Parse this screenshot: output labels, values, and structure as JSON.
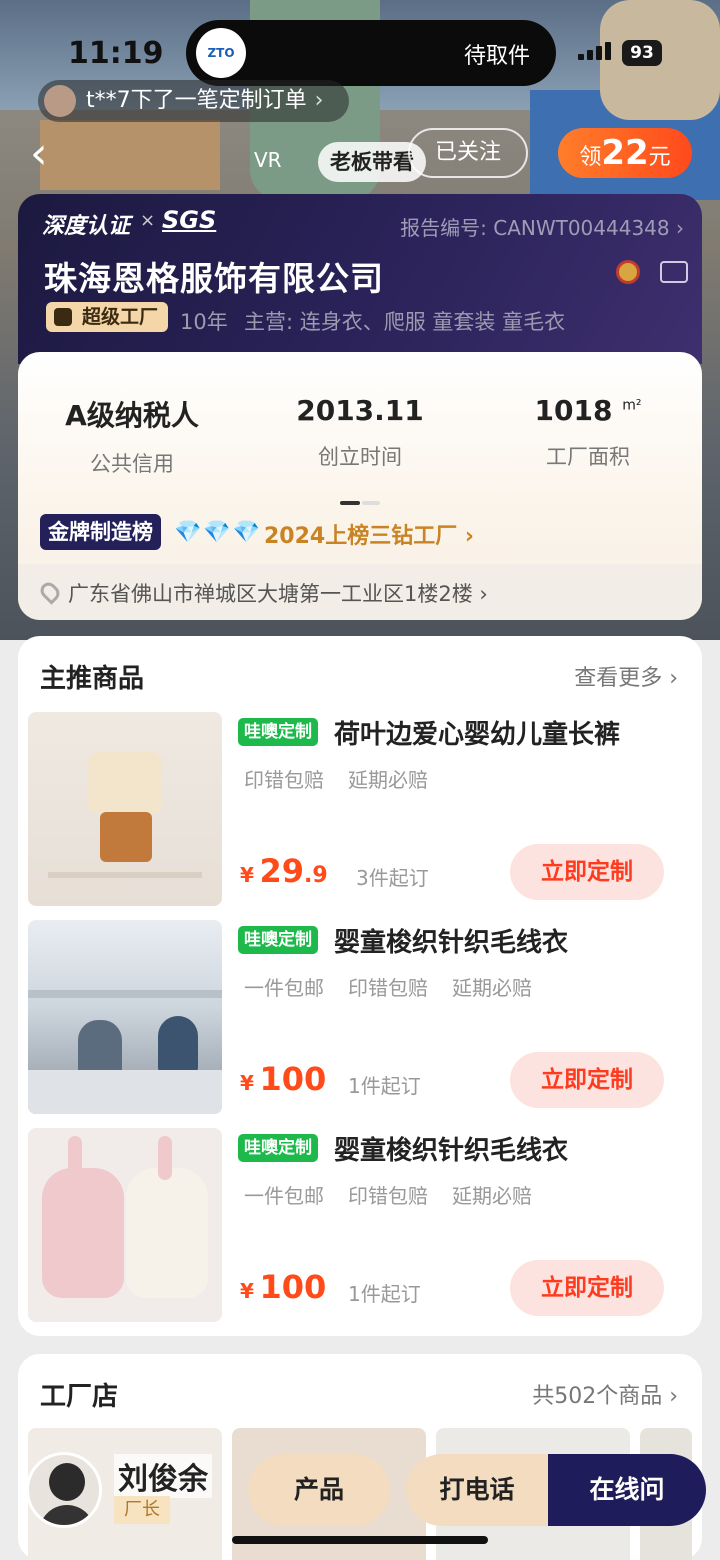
{
  "status_bar": {
    "time": "11:19",
    "island_text": "待取件",
    "island_logo": "ZTO",
    "battery": "93"
  },
  "ticker": {
    "text": "t**7下了一笔定制订单",
    "chevron": "›"
  },
  "nav": {
    "back": "‹",
    "vr": "VR",
    "boss_tour": "老板带看",
    "follow": "已关注"
  },
  "coupon": {
    "prefix": "领",
    "amount": "22",
    "unit": "元"
  },
  "cert": {
    "brand": "深度认证",
    "times": "×",
    "sgs": "SGS",
    "report": "报告编号: CANWT00444348 ›",
    "company": "珠海恩格服饰有限公司",
    "super_badge": "超级工厂",
    "years": "10年",
    "main_business": "主营:  连身衣、爬服 童套装 童毛衣"
  },
  "stats": [
    {
      "value": "A级纳税人",
      "label": "公共信用"
    },
    {
      "value": "2013.11",
      "label": "创立时间"
    },
    {
      "value": "1018",
      "unit": "m²",
      "label": "工厂面积"
    }
  ],
  "rank": {
    "badge": "金牌制造榜",
    "diamonds": "💎💎💎",
    "text": "2024上榜三钻工厂 ›"
  },
  "address": {
    "text": "广东省佛山市禅城区大塘第一工业区1楼2楼 ›"
  },
  "featured": {
    "title": "主推商品",
    "more": "查看更多 ›",
    "products": [
      {
        "tag": "哇噢定制",
        "name": "荷叶边爱心婴幼儿童长裤",
        "features": [
          "印错包赔",
          "延期必赔"
        ],
        "currency": "¥",
        "price_int": "29",
        "price_dec": ".9",
        "moq": "3件起订",
        "button": "立即定制"
      },
      {
        "tag": "哇噢定制",
        "name": "婴童梭织针织毛线衣",
        "features": [
          "一件包邮",
          "印错包赔",
          "延期必赔"
        ],
        "currency": "¥",
        "price_int": "100",
        "price_dec": "",
        "moq": "1件起订",
        "button": "立即定制"
      },
      {
        "tag": "哇噢定制",
        "name": "婴童梭织针织毛线衣",
        "features": [
          "一件包邮",
          "印错包赔",
          "延期必赔"
        ],
        "currency": "¥",
        "price_int": "100",
        "price_dec": "",
        "moq": "1件起订",
        "button": "立即定制"
      }
    ]
  },
  "factory_store": {
    "title": "工厂店",
    "count": "共502个商品 ›"
  },
  "bottom_bar": {
    "manager_name": "刘俊余",
    "manager_title": "厂长",
    "products": "产品",
    "call": "打电话",
    "online": "在线问"
  },
  "colors": {
    "accent_orange": "#ff4a1a",
    "brand_navy": "#1e1c5a",
    "tag_green": "#1eb94b",
    "gold": "#c98323"
  }
}
